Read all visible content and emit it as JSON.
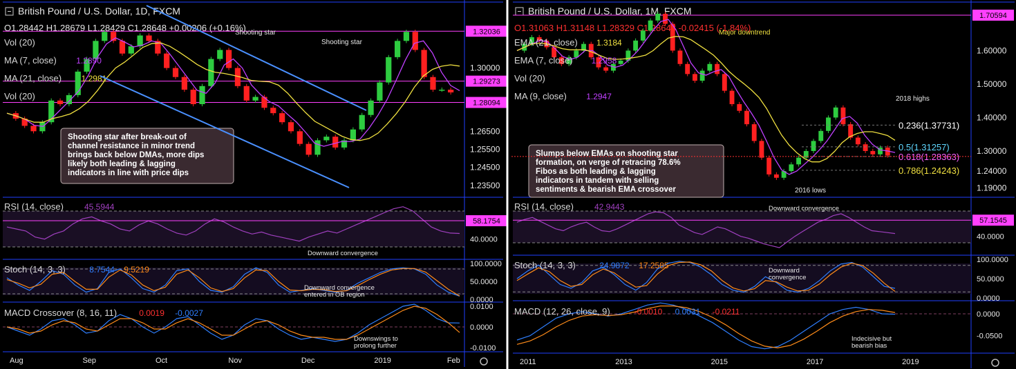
{
  "colors": {
    "background": "#000000",
    "separator": "#ffffff",
    "pane_border": "#1f3fff",
    "price_tag": "#ff40ff",
    "magenta_line": "#ff40ff",
    "up_candle": "#2ecc40",
    "down_candle": "#ff2020",
    "ma_fast": "#c040ff",
    "ma_slow": "#f0e040",
    "channel": "#4a90ff",
    "annotation": "#e06080",
    "note_bg": "#3a2a30",
    "note_border": "#c0b0b0",
    "rsi_line": "#a040c0",
    "stoch_k": "#2f7fff",
    "stoch_d": "#ff8c1a",
    "macd_line": "#2f7fff",
    "macd_signal": "#ff8c1a"
  },
  "icons": [
    "collapse-square-icon",
    "gear-icon"
  ],
  "chart_data": [
    {
      "type": "line",
      "panel": "left",
      "title": "British Pound / U.S. Dollar, 1D, FXCM",
      "ohlc": {
        "o": "1.28442",
        "h": "1.28679",
        "l": "1.28429",
        "c": "1.28648",
        "chg": "+0.00206 (+0.16%)"
      },
      "legend_lines": [
        {
          "label": "Vol (20)",
          "value": ""
        },
        {
          "label": "MA (7, close)",
          "value": "1.2890"
        },
        {
          "label": "MA (21, close)",
          "value": "1.2981"
        },
        {
          "label": "Vol (20)",
          "value": ""
        }
      ],
      "x_ticks": [
        "Aug",
        "Sep",
        "Oct",
        "Nov",
        "Dec",
        "2019",
        "Feb"
      ],
      "y_ticks": [
        "1.30000",
        "1.26500",
        "1.25500",
        "1.24500",
        "1.23500"
      ],
      "ylim": [
        1.23,
        1.33
      ],
      "price_tags": [
        "1.32036",
        "1.29273",
        "1.28094"
      ],
      "series": [
        {
          "name": "Price",
          "values": [
            1.275,
            1.272,
            1.268,
            1.265,
            1.27,
            1.282,
            1.28,
            1.285,
            1.298,
            1.305,
            1.315,
            1.32,
            1.315,
            1.308,
            1.312,
            1.318,
            1.315,
            1.308,
            1.3,
            1.295,
            1.288,
            1.28,
            1.29,
            1.305,
            1.31,
            1.3,
            1.29,
            1.282,
            1.284,
            1.278,
            1.275,
            1.27,
            1.265,
            1.258,
            1.252,
            1.26,
            1.262,
            1.256,
            1.26,
            1.266,
            1.274,
            1.282,
            1.292,
            1.306,
            1.315,
            1.32,
            1.31,
            1.295,
            1.288,
            1.288,
            1.2865
          ]
        }
      ],
      "annotations": [
        {
          "text": "Shooting star"
        },
        {
          "text": "Shooting star"
        },
        {
          "text": "Downward convergence"
        },
        {
          "text": "Downward convergence entered in OB region"
        },
        {
          "text": "Downswings to prolong further"
        }
      ],
      "note": "Shooting star after break-out of channel resistance in minor trend brings back below DMAs, more dips likely both leading & lagging indicators in line with price dips",
      "rsi": {
        "label": "RSI (14, close)",
        "value": "45.5944",
        "tag": "58.1754",
        "y_ticks": [
          "40.0000"
        ],
        "values": [
          52,
          50,
          48,
          42,
          40,
          45,
          48,
          55,
          60,
          62,
          58,
          55,
          50,
          48,
          54,
          58,
          55,
          50,
          46,
          44,
          48,
          55,
          60,
          57,
          52,
          48,
          45,
          47,
          44,
          42,
          40,
          38,
          42,
          45,
          48,
          46,
          50,
          54,
          58,
          62,
          66,
          70,
          72,
          68,
          60,
          52,
          48,
          46,
          45.6
        ]
      },
      "stoch": {
        "label": "Stoch (14, 3, 3)",
        "k": "8.7544",
        "d": "9.5219",
        "y_ticks": [
          "100.0000",
          "50.0000",
          "0.0000"
        ],
        "k_values": [
          60,
          40,
          25,
          50,
          80,
          70,
          40,
          20,
          30,
          75,
          85,
          60,
          30,
          20,
          40,
          80,
          85,
          50,
          25,
          20,
          35,
          70,
          88,
          75,
          40,
          20,
          25,
          30,
          25,
          20,
          25,
          45,
          60,
          75,
          85,
          88,
          85,
          70,
          40,
          20,
          8.8
        ],
        "d_values": [
          55,
          45,
          32,
          42,
          70,
          75,
          50,
          28,
          28,
          62,
          82,
          68,
          40,
          24,
          34,
          70,
          82,
          60,
          32,
          22,
          30,
          60,
          82,
          80,
          50,
          26,
          24,
          28,
          27,
          22,
          24,
          38,
          55,
          70,
          82,
          86,
          86,
          76,
          52,
          28,
          9.5
        ]
      },
      "macd": {
        "label": "MACD Crossover (8, 16, 11)",
        "macd": "0.0019",
        "signal": "-0.0027",
        "y_ticks": [
          "0.0100",
          "0.0000",
          "-0.0100"
        ],
        "macd_values": [
          0.0,
          -0.002,
          -0.004,
          -0.001,
          0.003,
          0.004,
          0.001,
          -0.003,
          -0.002,
          0.003,
          0.006,
          0.004,
          0.0,
          -0.003,
          0.0,
          0.004,
          0.005,
          0.001,
          -0.003,
          -0.006,
          -0.004,
          0.001,
          0.004,
          0.003,
          -0.001,
          -0.004,
          -0.006,
          -0.005,
          -0.006,
          -0.007,
          -0.006,
          -0.003,
          0.001,
          0.004,
          0.007,
          0.01,
          0.011,
          0.008,
          0.004,
          0.002,
          0.0019
        ],
        "signal_values": [
          0.0,
          -0.001,
          -0.003,
          -0.002,
          0.001,
          0.003,
          0.002,
          -0.001,
          -0.002,
          0.001,
          0.004,
          0.004,
          0.002,
          -0.001,
          -0.001,
          0.002,
          0.004,
          0.002,
          -0.001,
          -0.004,
          -0.004,
          -0.001,
          0.002,
          0.003,
          0.001,
          -0.002,
          -0.004,
          -0.005,
          -0.005,
          -0.006,
          -0.006,
          -0.004,
          -0.001,
          0.002,
          0.005,
          0.008,
          0.01,
          0.009,
          0.006,
          0.002,
          -0.0027
        ]
      }
    },
    {
      "type": "line",
      "panel": "right",
      "title": "British Pound / U.S. Dollar, 1M, FXCM",
      "ohlc": {
        "o": "1.31063",
        "h": "1.31148",
        "l": "1.28329",
        "c": "1.28648",
        "chg": "-0.02415 (-1.84%)"
      },
      "legend_lines": [
        {
          "label": "EMA (21, close)",
          "value": "1.3184"
        },
        {
          "label": "EMA (7, close)",
          "value": "1.2958"
        },
        {
          "label": "Vol (20)",
          "value": ""
        },
        {
          "label": "MA (9, close)",
          "value": "1.2947"
        }
      ],
      "x_ticks": [
        "2011",
        "2013",
        "2015",
        "2017",
        "2019"
      ],
      "y_ticks": [
        "1.60000",
        "1.50000",
        "1.40000",
        "1.30000",
        "1.24000",
        "1.19000"
      ],
      "ylim": [
        1.17,
        1.71
      ],
      "price_tags": [
        "1.70594"
      ],
      "series": [
        {
          "name": "Price",
          "values": [
            1.6,
            1.62,
            1.64,
            1.63,
            1.61,
            1.58,
            1.56,
            1.58,
            1.6,
            1.62,
            1.58,
            1.55,
            1.54,
            1.56,
            1.57,
            1.6,
            1.63,
            1.66,
            1.69,
            1.71,
            1.68,
            1.6,
            1.56,
            1.53,
            1.51,
            1.54,
            1.56,
            1.53,
            1.48,
            1.44,
            1.42,
            1.38,
            1.33,
            1.28,
            1.23,
            1.22,
            1.24,
            1.26,
            1.28,
            1.3,
            1.33,
            1.36,
            1.4,
            1.43,
            1.38,
            1.34,
            1.32,
            1.3,
            1.29,
            1.31,
            1.2865
          ]
        }
      ],
      "fib": [
        {
          "label": "0.236(1.37731)",
          "level": 1.37731
        },
        {
          "label": "0.5(1.31257)",
          "level": 1.31257
        },
        {
          "label": "0.618(1.28363)",
          "level": 1.28363
        },
        {
          "label": "0.786(1.24243)",
          "level": 1.24243
        }
      ],
      "annotations": [
        {
          "text": "Major downtrend"
        },
        {
          "text": "2018 highs"
        },
        {
          "text": "2016 lows"
        },
        {
          "text": "Downward convergence"
        },
        {
          "text": "Downward convergence"
        },
        {
          "text": "Indecisive but bearish bias"
        }
      ],
      "note": "Slumps below EMAs on shooting star formation, on verge of retracing 78.6% Fibos as both leading & lagging indicators in tandem with selling sentiments & bearish EMA crossover",
      "rsi": {
        "label": "RSI (14, close)",
        "value": "42.9443",
        "tag": "57.1545",
        "y_ticks": [
          "40.0000"
        ],
        "values": [
          55,
          58,
          60,
          56,
          52,
          48,
          46,
          50,
          53,
          55,
          50,
          46,
          45,
          48,
          52,
          56,
          60,
          64,
          66,
          65,
          60,
          52,
          48,
          44,
          42,
          46,
          50,
          48,
          44,
          40,
          38,
          35,
          32,
          30,
          28,
          34,
          40,
          45,
          50,
          55,
          58,
          62,
          64,
          60,
          55,
          50,
          46,
          45,
          44,
          43
        ]
      },
      "stoch": {
        "label": "Stoch (14, 3, 3)",
        "k": "24.9872",
        "d": "17.2585",
        "y_ticks": [
          "100.0000",
          "50.0000",
          "0.0000"
        ],
        "k_values": [
          50,
          70,
          85,
          60,
          35,
          25,
          40,
          70,
          80,
          60,
          35,
          20,
          40,
          75,
          90,
          95,
          92,
          80,
          60,
          35,
          20,
          15,
          30,
          55,
          40,
          20,
          15,
          25,
          45,
          70,
          88,
          92,
          80,
          55,
          30,
          25
        ],
        "d_values": [
          45,
          62,
          78,
          68,
          45,
          30,
          35,
          60,
          75,
          65,
          45,
          28,
          32,
          62,
          84,
          92,
          93,
          86,
          70,
          45,
          26,
          18,
          24,
          45,
          42,
          28,
          18,
          20,
          36,
          60,
          80,
          90,
          84,
          64,
          38,
          17
        ]
      },
      "macd": {
        "label": "MACD (12, 26, close, 9)",
        "macd": "-0.0010",
        "signal": "0.0031",
        "hist": "-0.0211",
        "y_ticks": [
          "0.0000",
          "-0.0500"
        ],
        "macd_values": [
          -0.06,
          -0.05,
          -0.03,
          -0.01,
          0.0,
          0.005,
          0.0,
          -0.005,
          0.0,
          0.01,
          0.02,
          0.025,
          0.02,
          0.01,
          -0.005,
          -0.02,
          -0.04,
          -0.06,
          -0.075,
          -0.08,
          -0.075,
          -0.06,
          -0.04,
          -0.02,
          0.0,
          0.01,
          0.015,
          0.01,
          0.0,
          -0.001
        ],
        "signal_values": [
          -0.07,
          -0.062,
          -0.048,
          -0.03,
          -0.015,
          -0.005,
          -0.002,
          -0.004,
          -0.002,
          0.004,
          0.012,
          0.018,
          0.018,
          0.014,
          0.005,
          -0.008,
          -0.025,
          -0.045,
          -0.062,
          -0.074,
          -0.078,
          -0.072,
          -0.058,
          -0.04,
          -0.02,
          -0.005,
          0.005,
          0.01,
          0.008,
          0.003
        ]
      }
    }
  ]
}
